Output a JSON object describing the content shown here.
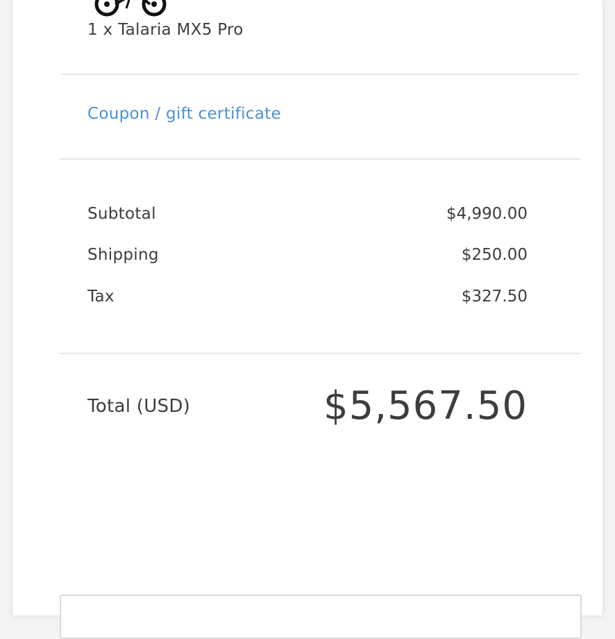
{
  "order_item": {
    "image_icon": "dirt-bike-icon",
    "name": "1 x Talaria MX5 Pro"
  },
  "coupon": {
    "link_label": "Coupon / gift certificate"
  },
  "summary": {
    "subtotal_label": "Subtotal",
    "subtotal_value": "$4,990.00",
    "shipping_label": "Shipping",
    "shipping_value": "$250.00",
    "tax_label": "Tax",
    "tax_value": "$327.50"
  },
  "total": {
    "label": "Total (USD)",
    "value": "$5,567.50"
  },
  "colors": {
    "link": "#4a92d4",
    "text": "#3d3d3d",
    "divider": "#e8e8e8"
  }
}
